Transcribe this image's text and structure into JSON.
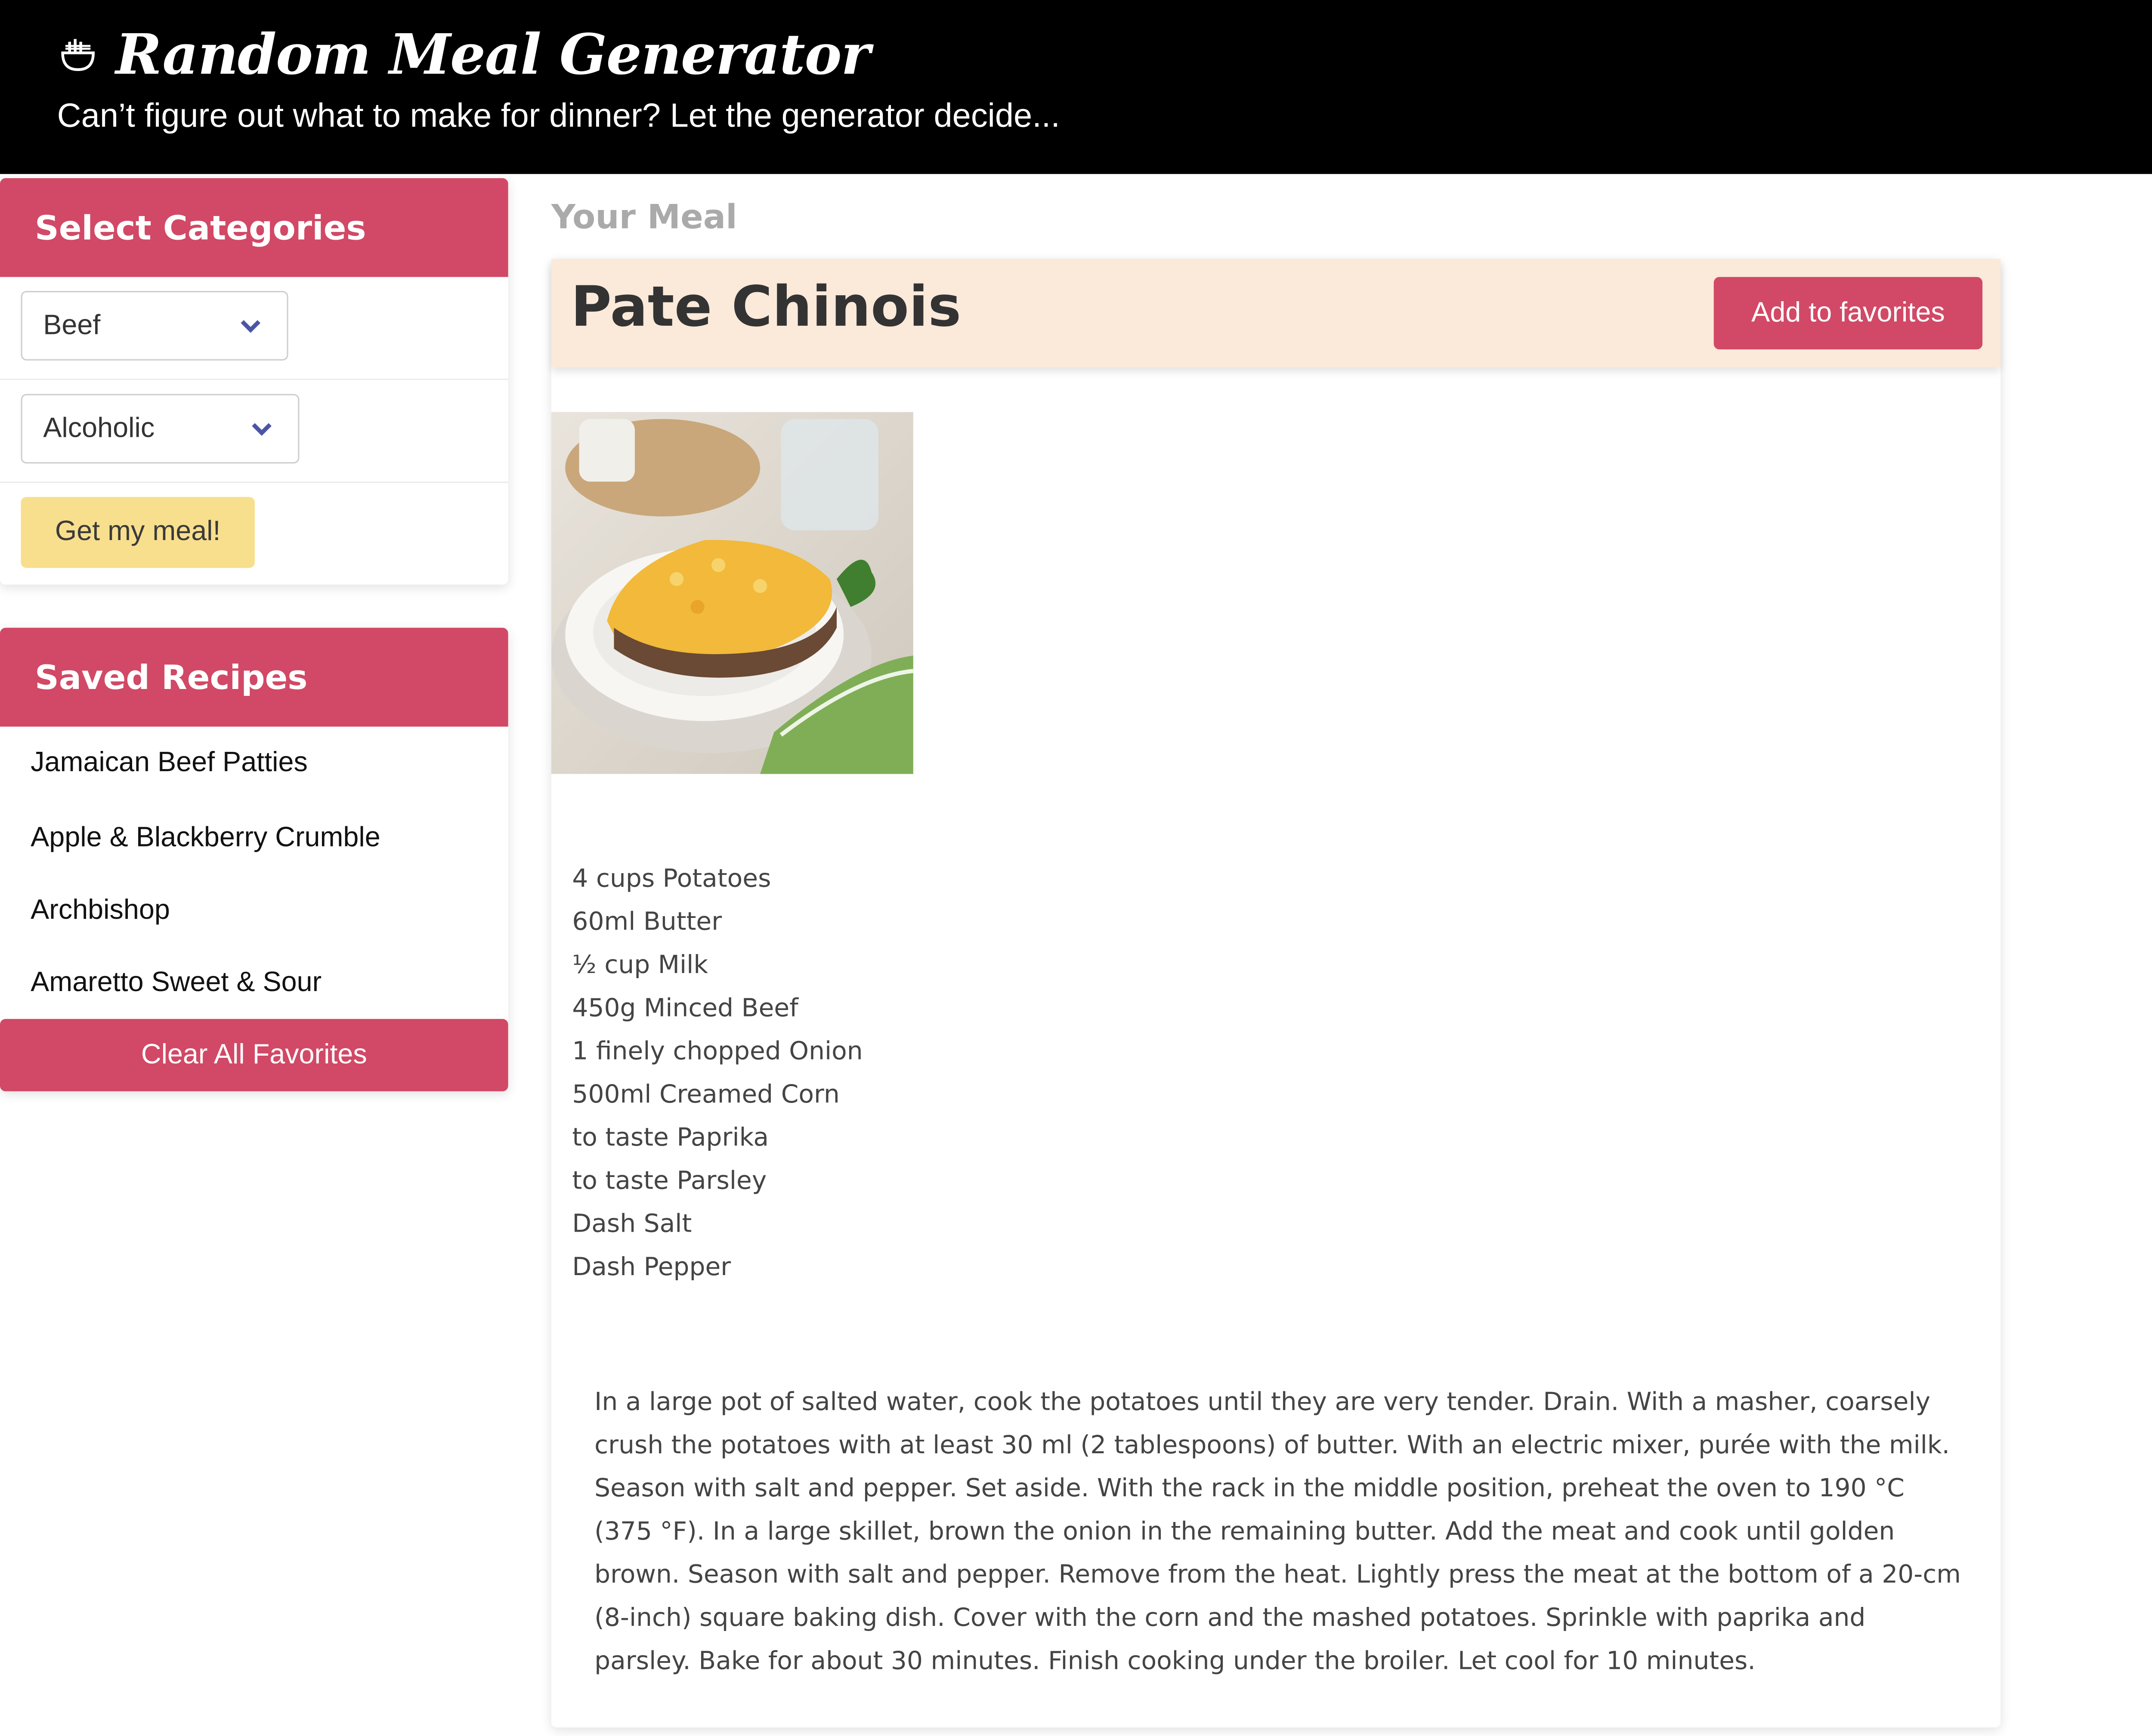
{
  "header": {
    "title": "Random Meal Generator",
    "subtitle": "Can’t figure out what to make for dinner? Let the generator decide...",
    "icon": "bowl-icon"
  },
  "categories": {
    "heading": "Select Categories",
    "meal_category": "Beef",
    "drink_category": "Alcoholic",
    "submit_label": "Get my meal!"
  },
  "saved": {
    "heading": "Saved Recipes",
    "items": [
      "Jamaican Beef Patties",
      "Apple & Blackberry Crumble",
      "Archbishop",
      "Amaretto Sweet & Sour"
    ],
    "clear_label": "Clear All Favorites"
  },
  "meal": {
    "section_label": "Your Meal",
    "name": "Pate Chinois",
    "favorite_label": "Add to favorites",
    "ingredients": [
      "4 cups Potatoes",
      "60ml Butter",
      "½ cup Milk",
      "450g Minced Beef",
      "1 finely chopped Onion",
      "500ml Creamed Corn",
      "to taste Paprika",
      "to taste Parsley",
      "Dash Salt",
      "Dash Pepper"
    ],
    "instructions": "In a large pot of salted water, cook the potatoes until they are very tender. Drain. With a masher, coarsely crush the potatoes with at least 30 ml (2 tablespoons) of butter. With an electric mixer, purée with the milk. Season with salt and pepper. Set aside. With the rack in the middle position, preheat the oven to 190 °C (375 °F). In a large skillet, brown the onion in the remaining butter. Add the meat and cook until golden brown. Season with salt and pepper. Remove from the heat. Lightly press the meat at the bottom of a 20-cm (8-inch) square baking dish. Cover with the corn and the mashed potatoes. Sprinkle with paprika and parsley. Bake for about 30 minutes. Finish cooking under the broiler. Let cool for 10 minutes."
  },
  "colors": {
    "accent": "#d14966",
    "button_yellow": "#f8df8d",
    "meal_header_bg": "#fbe9da",
    "chevron": "#4a55a8"
  }
}
